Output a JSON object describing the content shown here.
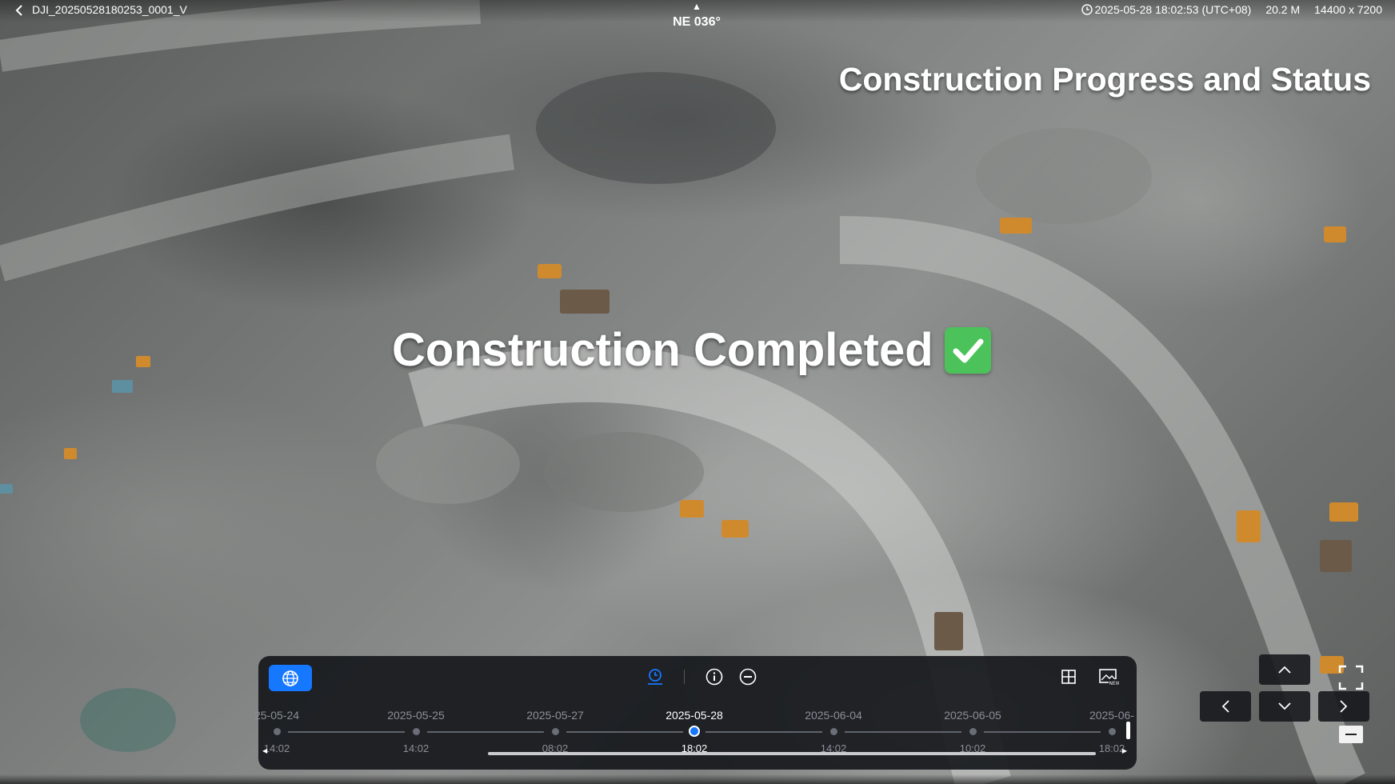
{
  "topbar": {
    "file_name": "DJI_20250528180253_0001_V",
    "compass_heading": "NE 036°",
    "timestamp": "2025-05-28 18:02:53 (UTC+08)",
    "altitude": "20.2 M",
    "resolution": "14400 x 7200"
  },
  "overlay": {
    "title": "Construction Progress and Status",
    "status": "Construction Completed"
  },
  "timeline": {
    "dates": [
      "25-05-24",
      "2025-05-25",
      "2025-05-27",
      "2025-05-28",
      "2025-06-04",
      "2025-06-05",
      "2025-06-"
    ],
    "times": [
      "14:02",
      "14:02",
      "08:02",
      "18:02",
      "14:02",
      "10:02",
      "18:02"
    ],
    "active_index": 3
  },
  "icons": {
    "back": "chevron-left-icon",
    "clock": "clock-icon",
    "globe": "globe-icon",
    "timeline": "timeline-icon",
    "info": "info-icon",
    "minus": "minus-circle-icon",
    "grid": "grid-icon",
    "new_image": "new-image-icon",
    "fullscreen": "fullscreen-icon",
    "zoom_out": "zoom-out-icon"
  },
  "colors": {
    "accent": "#1677ff",
    "check": "#4cc35a",
    "panel": "#16181c"
  }
}
